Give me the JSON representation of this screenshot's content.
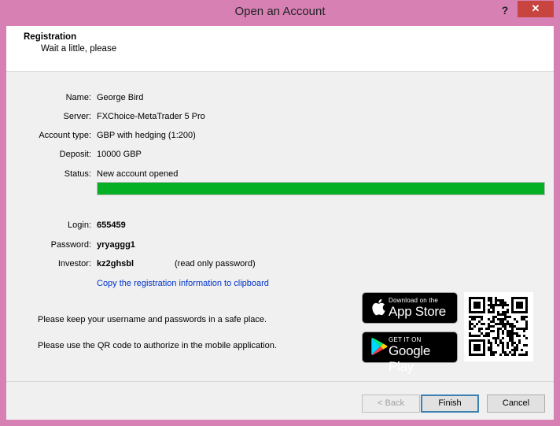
{
  "window": {
    "title": "Open an Account",
    "help_label": "?",
    "close_label": "✕"
  },
  "header": {
    "title": "Registration",
    "subtitle": "Wait a little, please"
  },
  "details": {
    "name_label": "Name:",
    "name_value": "George Bird",
    "server_label": "Server:",
    "server_value": "FXChoice-MetaTrader 5 Pro",
    "account_type_label": "Account type:",
    "account_type_value": "GBP with hedging (1:200)",
    "deposit_label": "Deposit:",
    "deposit_value": "10000 GBP",
    "status_label": "Status:",
    "status_value": "New account opened",
    "progress_fraction": 1.0,
    "progress_color": "#06b025"
  },
  "credentials": {
    "login_label": "Login:",
    "login_value": "655459",
    "password_label": "Password:",
    "password_value": "yryaggg1",
    "investor_label": "Investor:",
    "investor_value": "kz2ghsbl",
    "investor_note": "(read only password)"
  },
  "copy_link": "Copy the registration information to clipboard",
  "notes": {
    "safe_place": "Please keep your username and passwords in a safe place.",
    "qr_hint": "Please use the QR code to authorize in the mobile application."
  },
  "badges": {
    "appstore_small": "Download on the",
    "appstore_big": "App Store",
    "googleplay_small": "GET IT ON",
    "googleplay_big": "Google Play"
  },
  "buttons": {
    "back": "< Back",
    "finish": "Finish",
    "cancel": "Cancel"
  },
  "colors": {
    "window_frame": "#d680b4",
    "link": "#0033cc",
    "close_button": "#c7443f"
  }
}
